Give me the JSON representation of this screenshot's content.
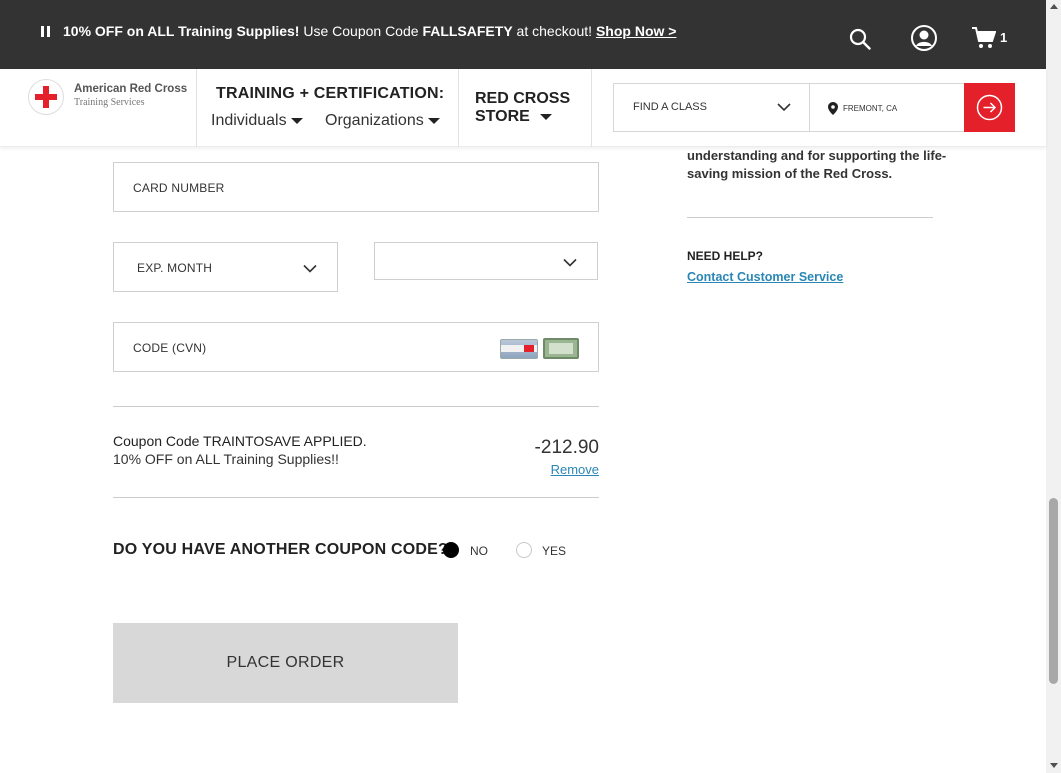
{
  "promo": {
    "bold_text": "10% OFF on ALL Training Supplies!",
    "text": " Use Coupon Code ",
    "code": "FALLSAFETY",
    "suffix": " at checkout! ",
    "shop_link": "Shop Now >",
    "cart_count": "1"
  },
  "header": {
    "logo_name": "American Red Cross",
    "logo_sub": "Training Services",
    "tc_title": "TRAINING + CERTIFICATION:",
    "nav_individuals": "Individuals",
    "nav_organizations": "Organizations",
    "store_line1": "RED CROSS",
    "store_line2": "STORE",
    "find_class": "FIND A CLASS",
    "location": "FREMONT, CA"
  },
  "form": {
    "card_number_label": "CARD NUMBER",
    "exp_month_label": "EXP. MONTH",
    "exp_year_value": "",
    "cvn_label": "CODE (CVN)",
    "coupon_applied": "Coupon Code TRAINTOSAVE APPLIED.",
    "coupon_desc": "10% OFF on ALL Training Supplies!!",
    "discount_amount": "-212.90",
    "remove_label": "Remove",
    "another_coupon_question": "DO YOU HAVE ANOTHER COUPON CODE?",
    "radio_no": "NO",
    "radio_yes": "YES",
    "selected_option": "NO",
    "place_order": "PLACE ORDER"
  },
  "sidebar": {
    "mission_text": "understanding and for supporting the life-saving mission of the Red Cross.",
    "need_help": "NEED HELP?",
    "contact_link": "Contact Customer Service"
  },
  "colors": {
    "brand_red": "#e4202a",
    "link_blue": "#2a86b5",
    "promo_bg": "#333333"
  }
}
